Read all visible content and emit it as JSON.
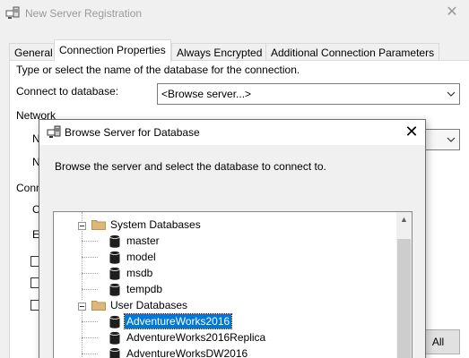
{
  "background_window": {
    "title": "New Server Registration",
    "tabs": [
      "General",
      "Connection Properties",
      "Always Encrypted",
      "Additional Connection Parameters"
    ],
    "active_tab": "Connection Properties",
    "instruction": "Type or select the name of the database for the connection.",
    "connect_label": "Connect to database:",
    "connect_value": "<Browse server...>",
    "network_label": "Network",
    "fragments": {
      "n1": "N",
      "n2": "N",
      "conn": "Conn",
      "c": "C",
      "e": "E"
    },
    "all_button": "All"
  },
  "dialog": {
    "title": "Browse Server for Database",
    "instruction": "Browse the server and select the database to connect to.",
    "tree": {
      "system_group": "System Databases",
      "system_dbs": [
        "master",
        "model",
        "msdb",
        "tempdb"
      ],
      "user_group": "User Databases",
      "user_dbs": [
        "AdventureWorks2016",
        "AdventureWorks2016Replica",
        "AdventureWorksDW2016"
      ],
      "selected": "AdventureWorks2016"
    }
  },
  "colors": {
    "selection": "#0078d7",
    "folder": "#dcb67a",
    "db_icon": "#1e1e1e"
  },
  "icons": {
    "server_registration": "server-registration-icon",
    "browse_server": "browse-server-icon",
    "folder": "folder-icon",
    "database": "database-icon",
    "close": "close-icon",
    "chevron_down": "chevron-down-icon",
    "collapse": "collapse-icon"
  }
}
